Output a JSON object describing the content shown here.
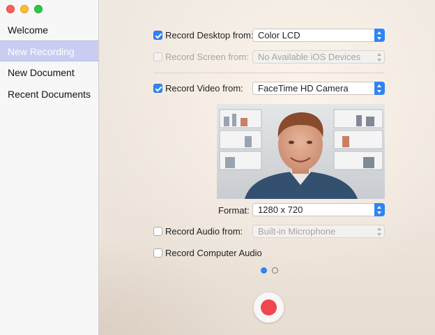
{
  "window": {
    "traffic_lights": [
      "close",
      "minimize",
      "zoom"
    ]
  },
  "sidebar": {
    "items": [
      {
        "label": "Welcome",
        "selected": false
      },
      {
        "label": "New Recording",
        "selected": true
      },
      {
        "label": "New Document",
        "selected": false
      },
      {
        "label": "Recent Documents",
        "selected": false
      }
    ]
  },
  "recording": {
    "desktop": {
      "label": "Record Desktop from:",
      "checked": true,
      "enabled": true,
      "value": "Color LCD"
    },
    "screen": {
      "label": "Record Screen from:",
      "checked": false,
      "enabled": false,
      "value": "No Available iOS Devices"
    },
    "video": {
      "label": "Record Video from:",
      "checked": true,
      "enabled": true,
      "value": "FaceTime HD Camera"
    },
    "format": {
      "label": "Format:",
      "value": "1280 x 720"
    },
    "audio": {
      "label": "Record Audio from:",
      "checked": false,
      "enabled": false,
      "value": "Built-in Microphone"
    },
    "computer_audio": {
      "label": "Record Computer Audio",
      "checked": false
    }
  },
  "pager": {
    "pages": 2,
    "current": 1
  },
  "colors": {
    "accent": "#2f84f6",
    "record": "#f0474c",
    "selection": "#c9cdf2"
  },
  "icons": [
    "checkmark-icon",
    "popup-arrows-icon",
    "record-icon"
  ]
}
